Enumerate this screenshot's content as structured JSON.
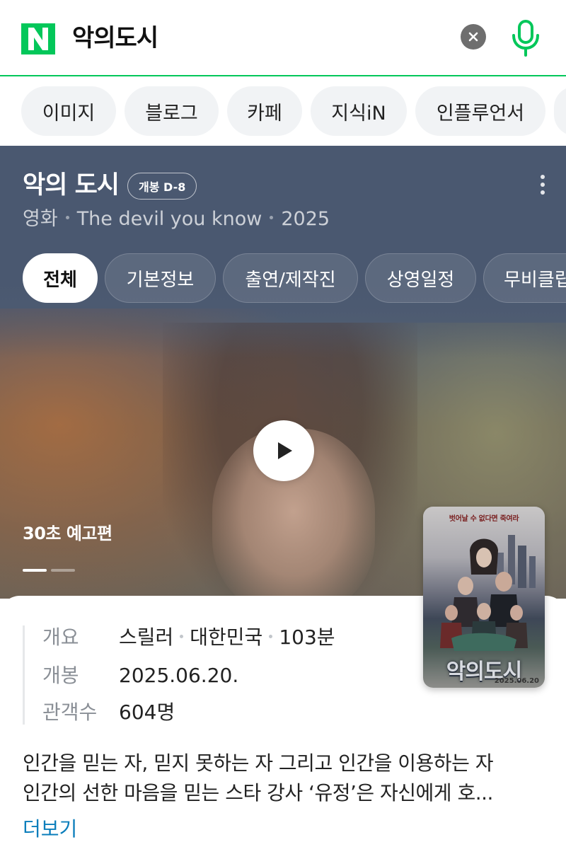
{
  "search": {
    "query": "악의도시"
  },
  "categories": [
    {
      "label": "이미지"
    },
    {
      "label": "블로그"
    },
    {
      "label": "카페"
    },
    {
      "label": "지식iN"
    },
    {
      "label": "인플루언서"
    }
  ],
  "movie": {
    "title": "악의 도시",
    "badge": "개봉 D-8",
    "meta": {
      "type": "영화",
      "english_title": "The devil you know",
      "year": "2025"
    },
    "tabs": [
      {
        "label": "전체",
        "active": true
      },
      {
        "label": "기본정보"
      },
      {
        "label": "출연/제작진"
      },
      {
        "label": "상영일정"
      },
      {
        "label": "무비클립"
      }
    ],
    "trailer_label": "30초 예고편",
    "trailer_slides": {
      "count": 2,
      "active_index": 0
    }
  },
  "poster": {
    "tagline": "벗어날 수 없다면 죽여라",
    "title": "악의도시",
    "date": "2025.06.20"
  },
  "info": {
    "rows": [
      {
        "key": "개요",
        "values": [
          "스릴러",
          "대한민국",
          "103분"
        ]
      },
      {
        "key": "개봉",
        "value": "2025.06.20."
      },
      {
        "key": "관객수",
        "value": "604명"
      }
    ]
  },
  "description": {
    "line1": "인간을 믿는 자, 믿지 못하는 자 그리고 인간을 이용하는 자",
    "line2": "인간의 선한 마음을 믿는 스타 강사 ‘유정’은 자신에게 호...",
    "more": "더보기"
  },
  "colors": {
    "naver_green": "#03c75a",
    "link_blue": "#0a7dbb",
    "panel_navy": "#4b5a72"
  }
}
